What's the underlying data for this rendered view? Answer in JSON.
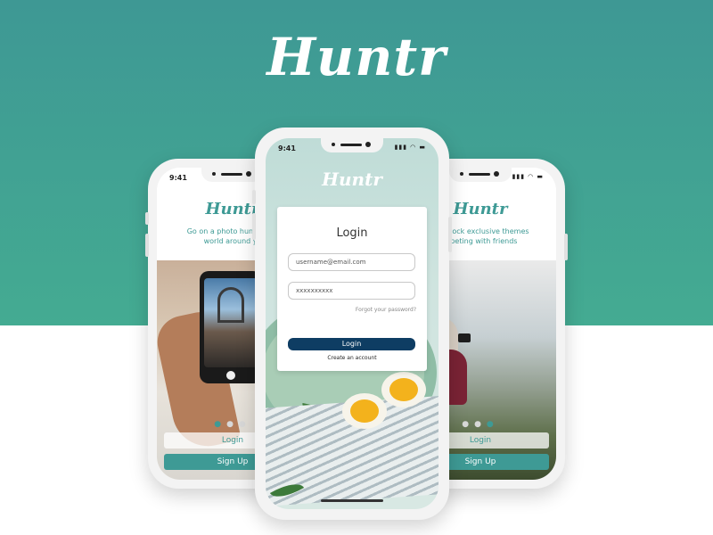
{
  "brand": {
    "name": "Huntr"
  },
  "phones": {
    "left": {
      "time": "9:41",
      "status_icons": "▮▮▮ ◠ ▬",
      "brand": "Huntr",
      "tagline": "Go on a photo hunt and e\nworld around yo",
      "dots": [
        "●",
        "●",
        "●"
      ],
      "login_label": "Login",
      "signup_label": "Sign Up"
    },
    "center": {
      "time": "9:41",
      "status_icons": "▮▮▮ ◠ ▬",
      "brand": "Huntr",
      "login": {
        "title": "Login",
        "username_value": "username@email.com",
        "password_value": "xxxxxxxxxx",
        "forgot_label": "Forgot your password?",
        "login_button": "Login",
        "create_account": "Create an account"
      }
    },
    "right": {
      "time": "",
      "status_icons": "▮▮▮ ◠ ▬",
      "brand": "Huntr",
      "tagline": "to unlock exclusive themes\nmpeting with friends",
      "dots": [
        "●",
        "●",
        "●"
      ],
      "login_label": "Login",
      "signup_label": "Sign Up"
    }
  },
  "colors": {
    "teal_top": "#3e9894",
    "teal_bottom": "#44ab92",
    "accent": "#3e9a95",
    "login_button": "#0e3d63"
  }
}
